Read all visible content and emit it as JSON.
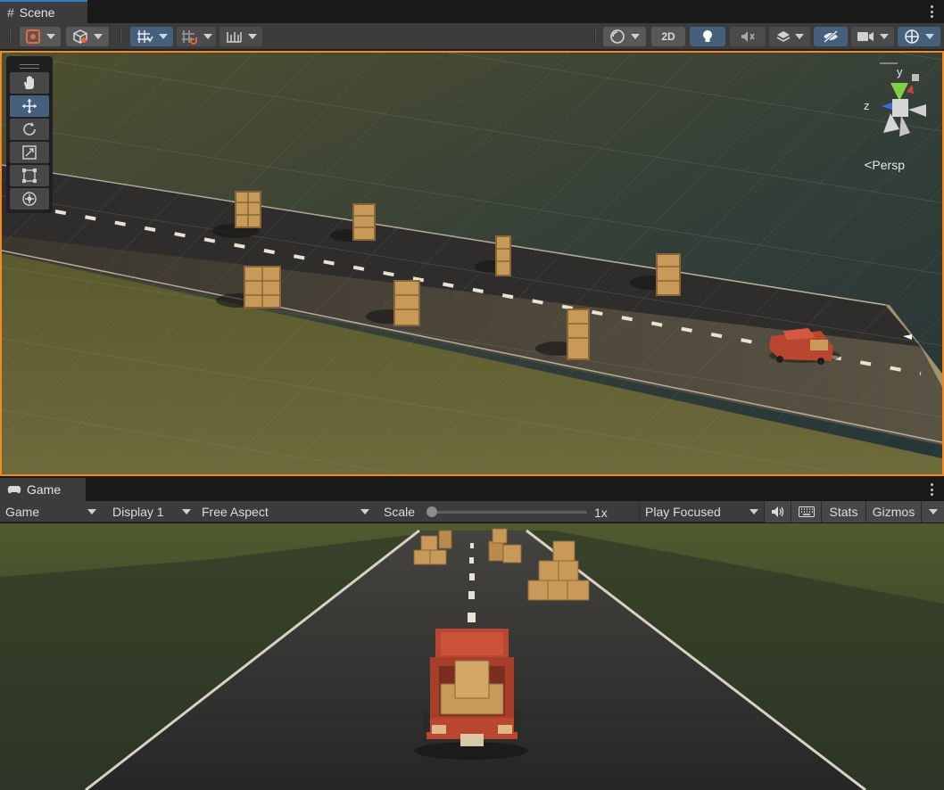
{
  "scene_tab": {
    "title": "Scene"
  },
  "scene_toolbar": {
    "two_d_label": "2D"
  },
  "scene_view": {
    "projection_label": "Persp",
    "axes": {
      "y": "y",
      "z": "z"
    }
  },
  "game_tab": {
    "title": "Game"
  },
  "game_toolbar": {
    "view_mode": "Game",
    "display": "Display 1",
    "aspect": "Free Aspect",
    "scale_label": "Scale",
    "scale_value": "1x",
    "scale_level": 0.0,
    "play_mode": "Play Focused",
    "stats_label": "Stats",
    "gizmos_label": "Gizmos"
  },
  "colors": {
    "accent_orange": "#f08a24",
    "tab_highlight": "#3a79bb",
    "toggle_on": "#46607c",
    "road": "#2d2b2a",
    "sand": "#9a8a68",
    "grass": "#5b5a30",
    "truck_red": "#b84630",
    "crate": "#c89a5a"
  }
}
